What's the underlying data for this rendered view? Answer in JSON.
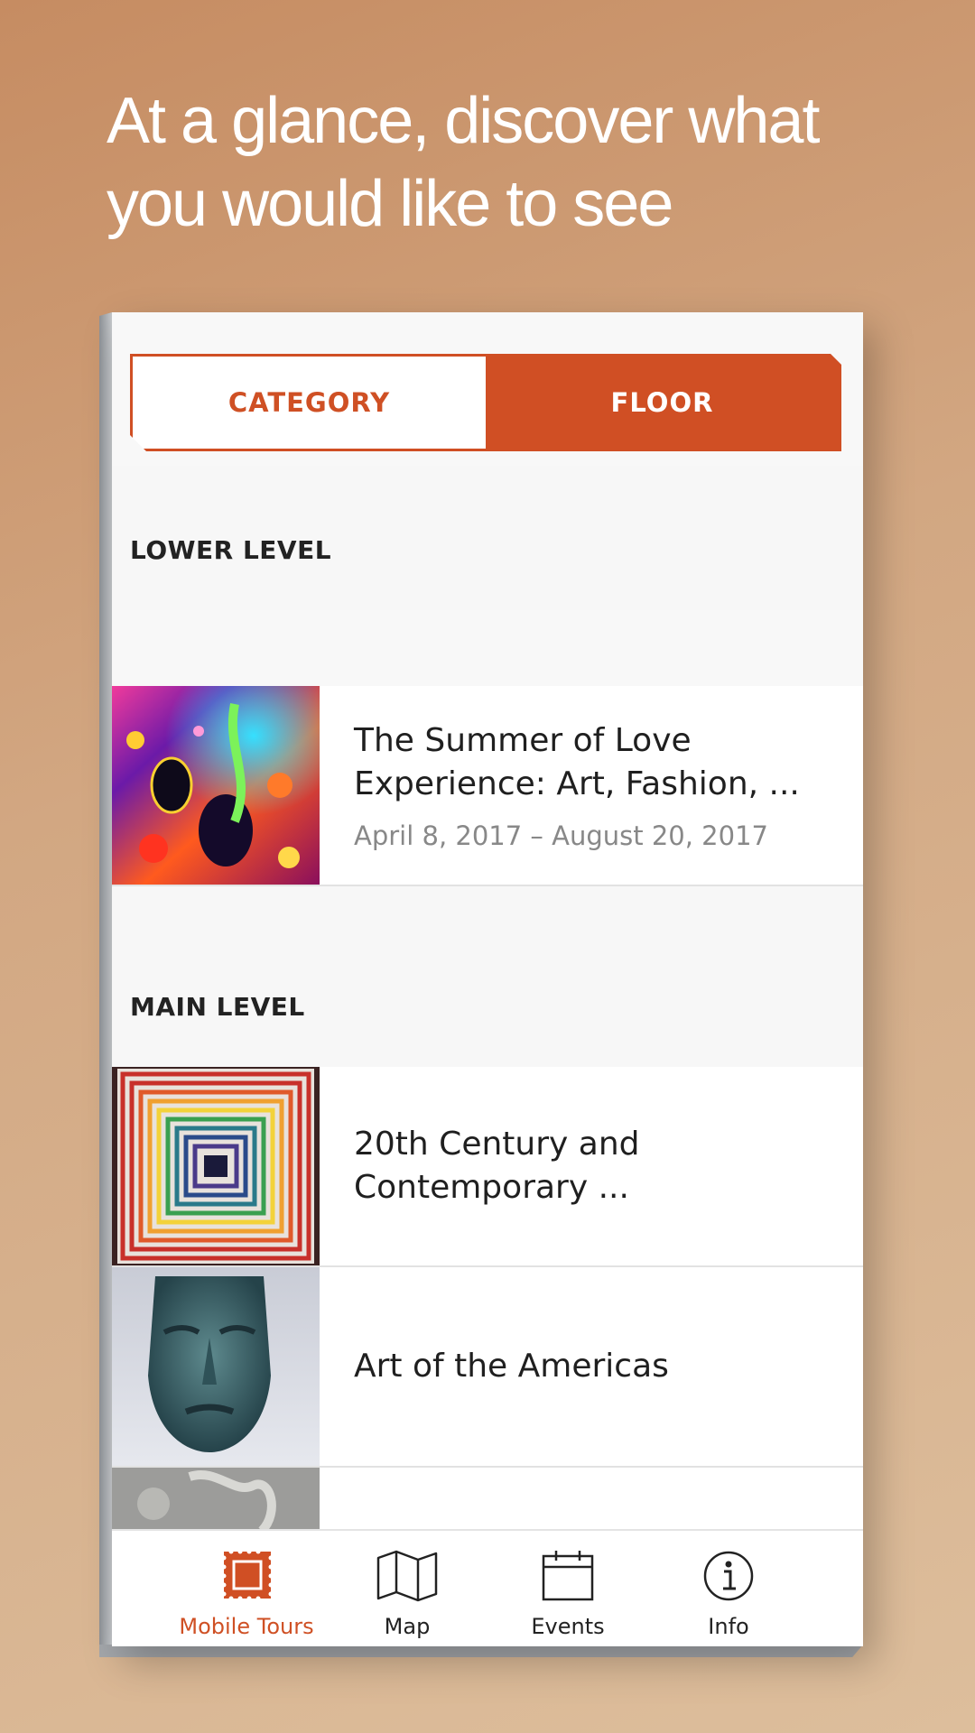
{
  "headline": {
    "line1": "At a glance, discover what",
    "line2": "you would like to see"
  },
  "segmented_control": {
    "options": [
      "CATEGORY",
      "FLOOR"
    ],
    "selected": "FLOOR"
  },
  "sections": [
    {
      "header": "LOWER LEVEL",
      "items": [
        {
          "title_line1": "The Summer of Love",
          "title_line2": "Experience: Art, Fashion, ...",
          "date": "April 8, 2017 – August 20, 2017"
        }
      ]
    },
    {
      "header": "MAIN LEVEL",
      "items": [
        {
          "title_line1": "20th Century and",
          "title_line2": "Contemporary ..."
        },
        {
          "title_line1": "Art of the Americas"
        }
      ]
    }
  ],
  "tab_bar": {
    "tabs": [
      {
        "label": "Mobile Tours",
        "icon": "stamp-icon",
        "active": true
      },
      {
        "label": "Map",
        "icon": "map-icon",
        "active": false
      },
      {
        "label": "Events",
        "icon": "calendar-icon",
        "active": false
      },
      {
        "label": "Info",
        "icon": "info-icon",
        "active": false
      }
    ]
  },
  "colors": {
    "accent": "#d04f24",
    "background_top": "#c68c62",
    "background_bottom": "#ddbe9c"
  }
}
